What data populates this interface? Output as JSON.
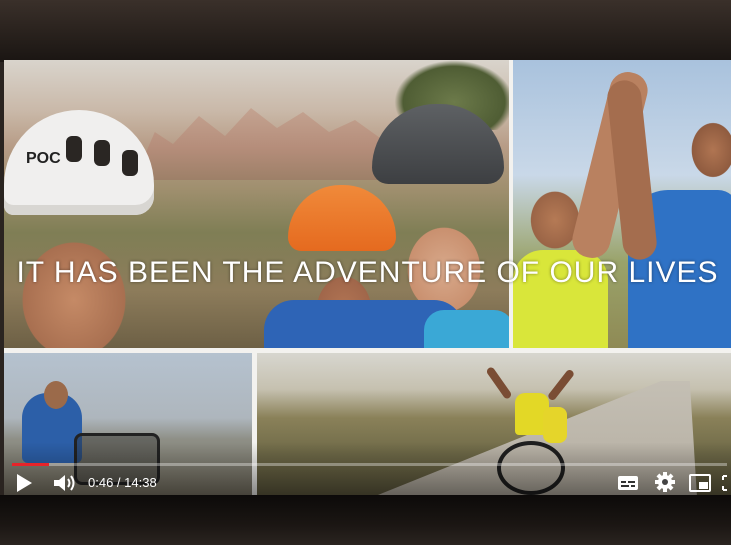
{
  "video": {
    "caption": "IT HAS BEEN THE ADVENTURE OF OUR LIVES",
    "helmet_logo": "POC"
  },
  "player": {
    "current_time": "0:46",
    "duration": "14:38",
    "time_display": "0:46 / 14:38",
    "progress_fraction": 0.052,
    "accent_color": "#e6242a",
    "controls": {
      "play_icon": "play-icon",
      "volume_icon": "volume-icon",
      "subtitles_icon": "subtitles-icon",
      "settings_icon": "gear-icon",
      "miniplayer_icon": "miniplayer-icon",
      "fullscreen_icon": "fullscreen-icon"
    }
  }
}
